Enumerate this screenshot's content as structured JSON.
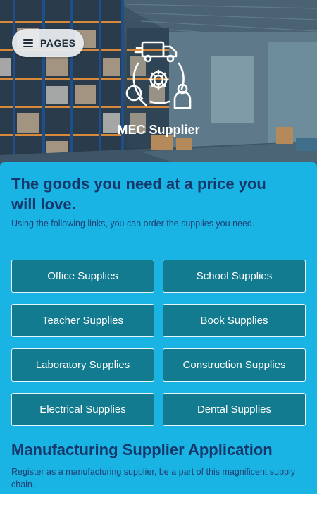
{
  "nav": {
    "pages_label": "PAGES"
  },
  "brand": {
    "name": "MEC Supplier"
  },
  "hero": {
    "headline": "The goods you need at a price you will love.",
    "subtext": "Using the following links, you can order the supplies you need."
  },
  "supplies": [
    {
      "label": "Office Supplies"
    },
    {
      "label": "School Supplies"
    },
    {
      "label": "Teacher Supplies"
    },
    {
      "label": "Book Supplies"
    },
    {
      "label": "Laboratory Supplies"
    },
    {
      "label": "Construction Supplies"
    },
    {
      "label": "Electrical Supplies"
    },
    {
      "label": "Dental Supplies"
    }
  ],
  "application": {
    "title": "Manufacturing Supplier Application",
    "description": "Register as a manufacturing supplier, be a part of this magnificent supply chain."
  },
  "colors": {
    "card_background": "#1ab4e4",
    "button_background": "#127b8f",
    "heading_text": "#14386b"
  },
  "icons": [
    "menu-icon",
    "truck-icon",
    "gear-icon",
    "magnifier-icon",
    "person-icon"
  ]
}
